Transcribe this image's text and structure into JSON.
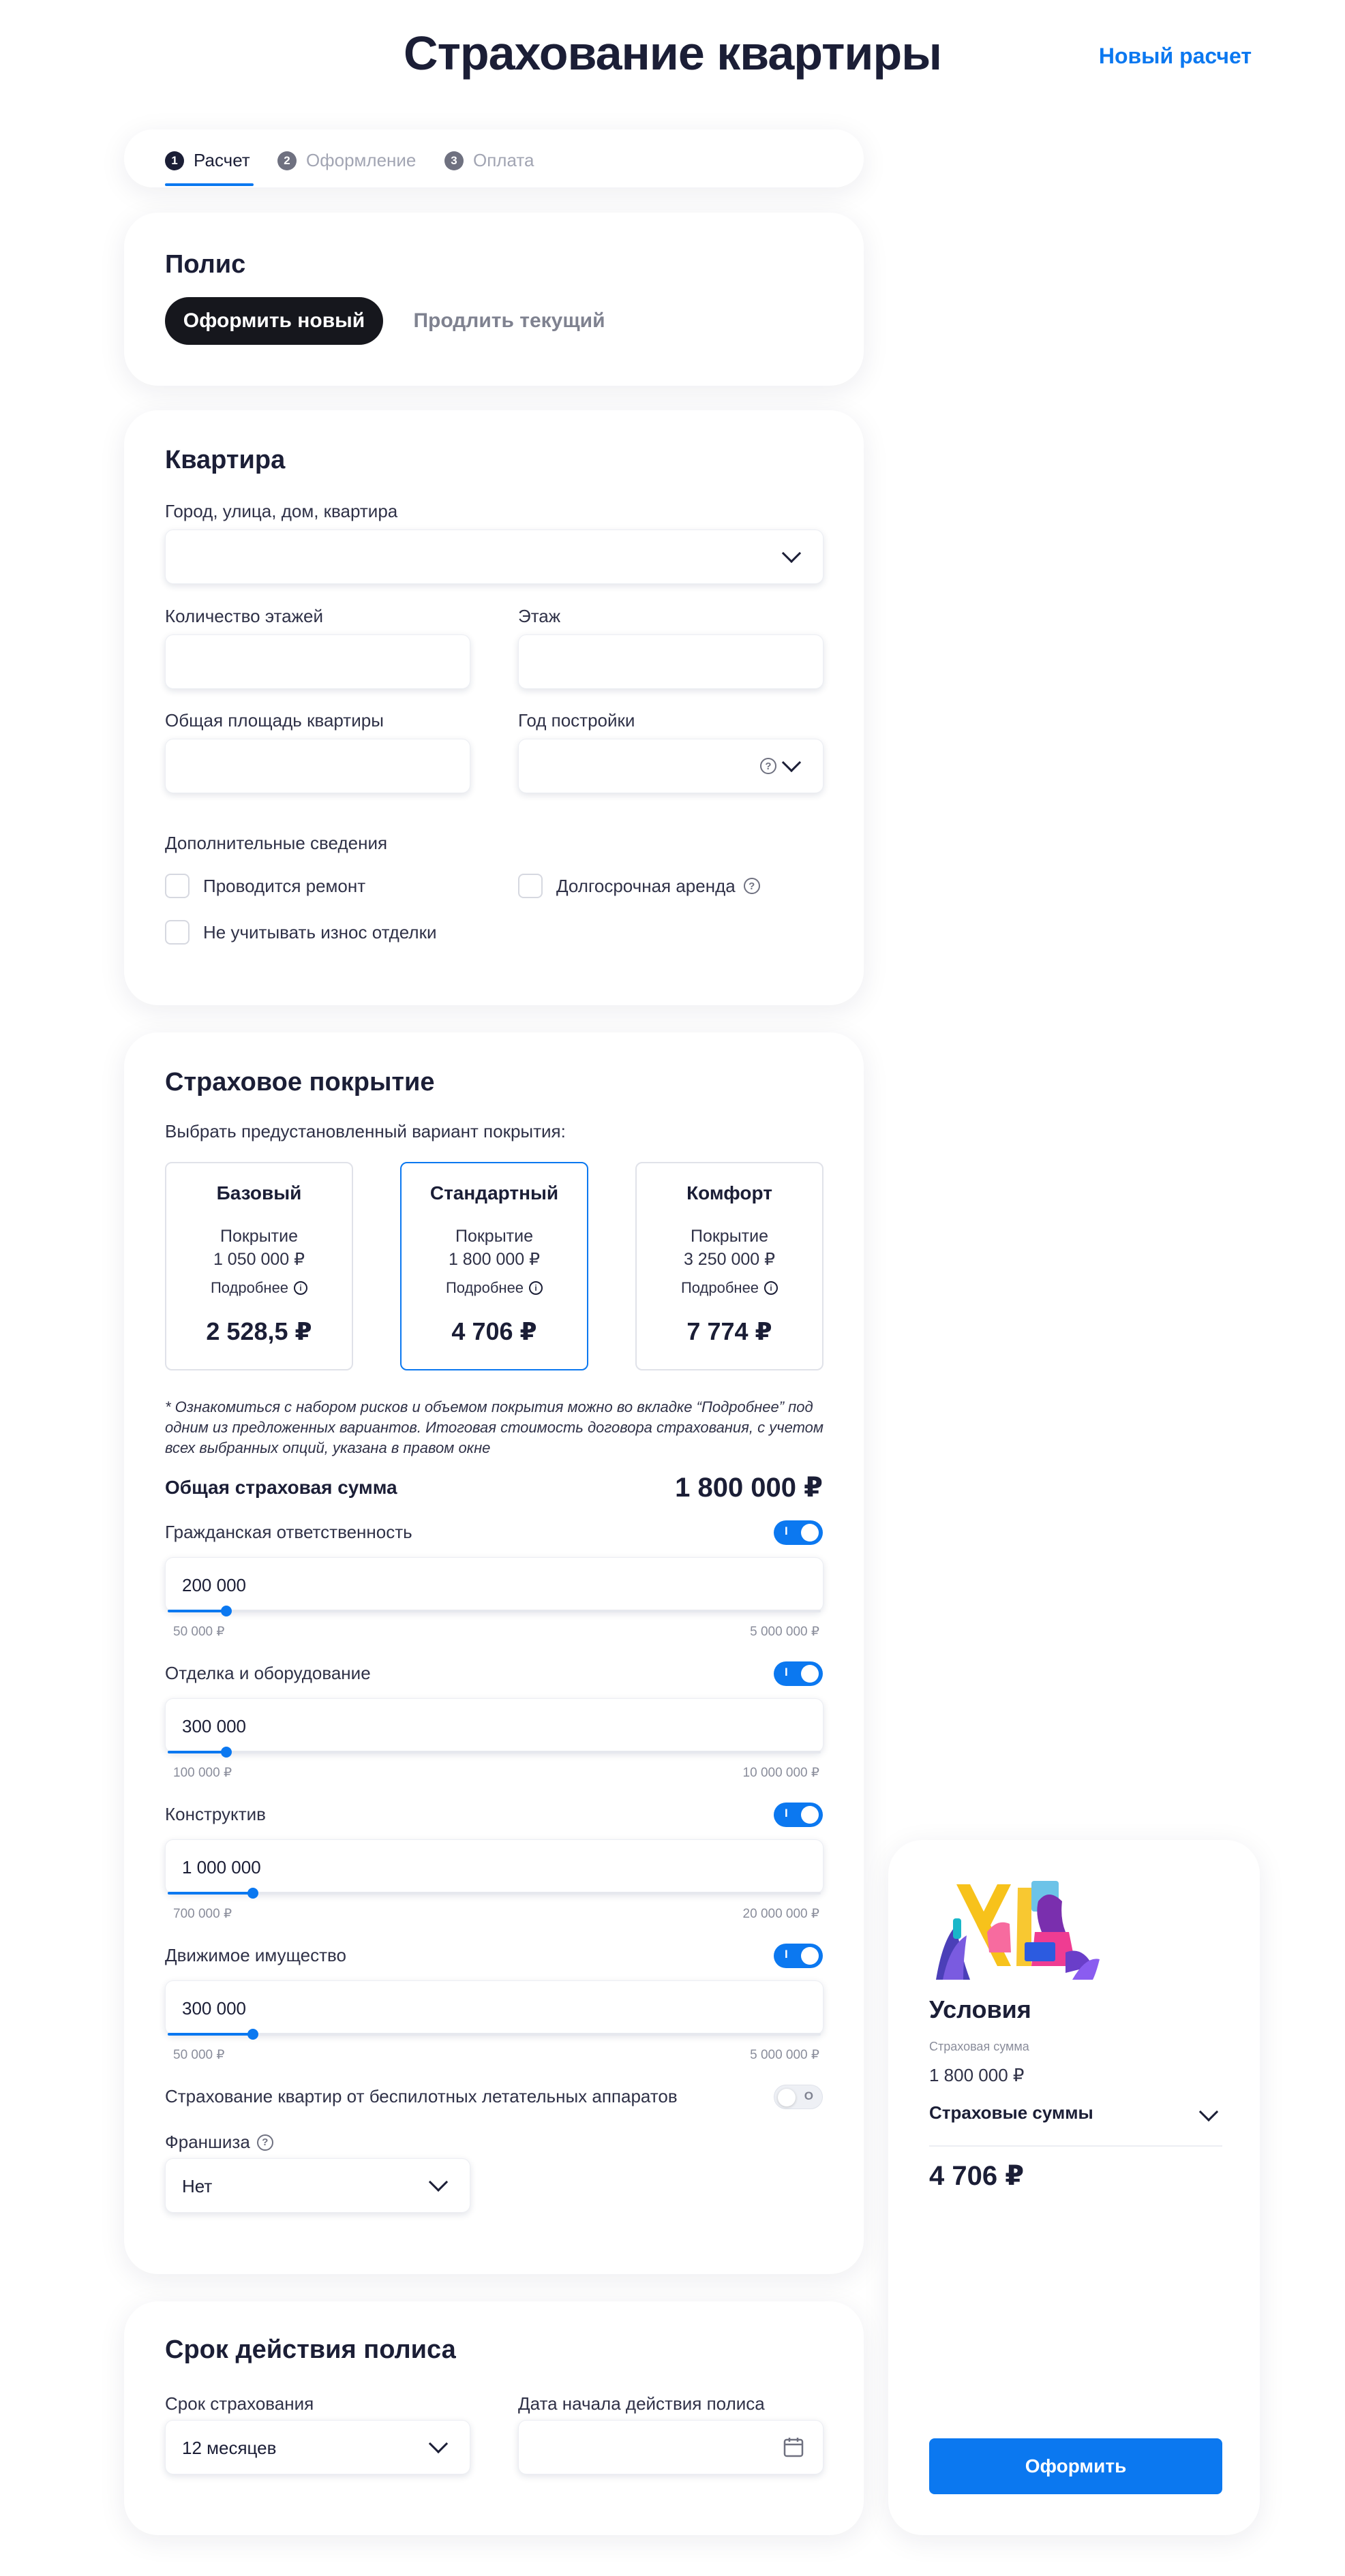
{
  "header": {
    "title": "Страхование квартиры",
    "new_calc": "Новый расчет"
  },
  "steps": [
    {
      "num": "1",
      "label": "Расчет",
      "active": true
    },
    {
      "num": "2",
      "label": "Оформление",
      "active": false
    },
    {
      "num": "3",
      "label": "Оплата",
      "active": false
    }
  ],
  "polis": {
    "title": "Полис",
    "new_label": "Оформить новый",
    "renew_label": "Продлить текущий"
  },
  "apartment": {
    "title": "Квартира",
    "address_label": "Город, улица, дом, квартира",
    "floors_label": "Количество этажей",
    "floor_label": "Этаж",
    "area_label": "Общая площадь квартиры",
    "year_label": "Год постройки",
    "extra_label": "Дополнительные сведения",
    "repair_label": "Проводится ремонт",
    "rent_label": "Долгосрочная аренда",
    "wear_label": "Не учитывать износ отделки"
  },
  "coverage": {
    "title": "Страховое покрытие",
    "subtitle": "Выбрать предустановленный вариант покрытия:",
    "plans": [
      {
        "name": "Базовый",
        "cov_label": "Покрытие",
        "cov_value": "1 050 000 ₽",
        "more": "Подробнее",
        "price": "2 528,5 ₽",
        "selected": false
      },
      {
        "name": "Стандартный",
        "cov_label": "Покрытие",
        "cov_value": "1 800 000 ₽",
        "more": "Подробнее",
        "price": "4 706 ₽",
        "selected": true
      },
      {
        "name": "Комфорт",
        "cov_label": "Покрытие",
        "cov_value": "3 250 000 ₽",
        "more": "Подробнее",
        "price": "7 774 ₽",
        "selected": false
      }
    ],
    "note": "* Ознакомиться с набором рисков и объемом покрытия можно во вкладке “Подробнее” под одним из предложенных вариантов. Итоговая стоимость договора страхования, с учетом всех выбранных опций, указана в правом окне",
    "total_label": "Общая страховая сумма",
    "total_value": "1 800 000 ₽",
    "items": [
      {
        "label": "Гражданская ответственность",
        "value": "200 000",
        "min": "50 000 ₽",
        "max": "5 000 000 ₽",
        "enabled": true,
        "level": 0.09
      },
      {
        "label": "Отделка и оборудование",
        "value": "300 000",
        "min": "100 000 ₽",
        "max": "10 000 000 ₽",
        "enabled": true,
        "level": 0.09
      },
      {
        "label": "Конструктив",
        "value": "1 000 000",
        "min": "700 000 ₽",
        "max": "20 000 000 ₽",
        "enabled": true,
        "level": 0.13
      },
      {
        "label": "Движимое имущество",
        "value": "300 000",
        "min": "50 000 ₽",
        "max": "5 000 000 ₽",
        "enabled": true,
        "level": 0.13
      }
    ],
    "drone_label": "Страхование квартир от беспилотных летательных аппаратов",
    "drone_enabled": false,
    "franchise_label": "Франшиза",
    "franchise_value": "Нет"
  },
  "term": {
    "title": "Срок действия полиса",
    "period_label": "Срок страхования",
    "period_value": "12 месяцев",
    "start_label": "Дата начала действия полиса"
  },
  "summary": {
    "title": "Условия",
    "sum_label": "Страховая сумма",
    "sum_value": "1 800 000 ₽",
    "dropdown_label": "Страховые суммы",
    "price": "4 706 ₽",
    "button": "Оформить"
  },
  "icons": {
    "toggle_on_mark": "I",
    "toggle_off_mark": "O",
    "question": "?",
    "info": "i"
  },
  "colors": {
    "accent": "#0b78f0",
    "dark": "#16171d",
    "text": "#1b1e36"
  }
}
